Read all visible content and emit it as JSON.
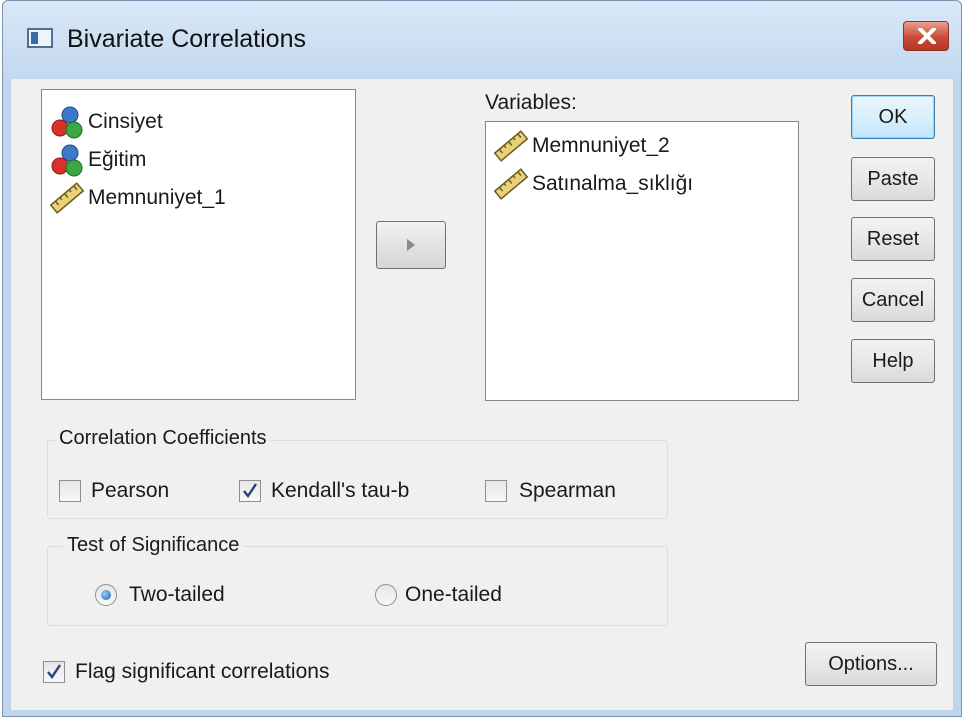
{
  "window": {
    "title": "Bivariate Correlations"
  },
  "source_list": {
    "items": [
      {
        "label": "Cinsiyet",
        "icon": "nominal-variable-icon"
      },
      {
        "label": "Eğitim",
        "icon": "nominal-variable-icon"
      },
      {
        "label": "Memnuniyet_1",
        "icon": "scale-variable-icon"
      }
    ]
  },
  "variables": {
    "label": "Variables:",
    "items": [
      {
        "label": "Memnuniyet_2",
        "icon": "scale-variable-icon"
      },
      {
        "label": "Satınalma_sıklığı",
        "icon": "scale-variable-icon"
      }
    ]
  },
  "buttons": {
    "ok": "OK",
    "paste": "Paste",
    "reset": "Reset",
    "cancel": "Cancel",
    "help": "Help",
    "options": "Options..."
  },
  "correlation_coefficients": {
    "title": "Correlation Coefficients",
    "pearson": {
      "label": "Pearson",
      "checked": false
    },
    "kendall": {
      "label": "Kendall's tau-b",
      "checked": true
    },
    "spearman": {
      "label": "Spearman",
      "checked": false
    }
  },
  "test_of_significance": {
    "title": "Test of Significance",
    "two_tailed": {
      "label": "Two-tailed",
      "selected": true
    },
    "one_tailed": {
      "label": "One-tailed",
      "selected": false
    }
  },
  "flag_significant": {
    "label": "Flag significant correlations",
    "checked": true
  },
  "colors": {
    "title_bar": "#c9dcf0",
    "close_button": "#c94a36",
    "accent": "#3c7fb1"
  }
}
